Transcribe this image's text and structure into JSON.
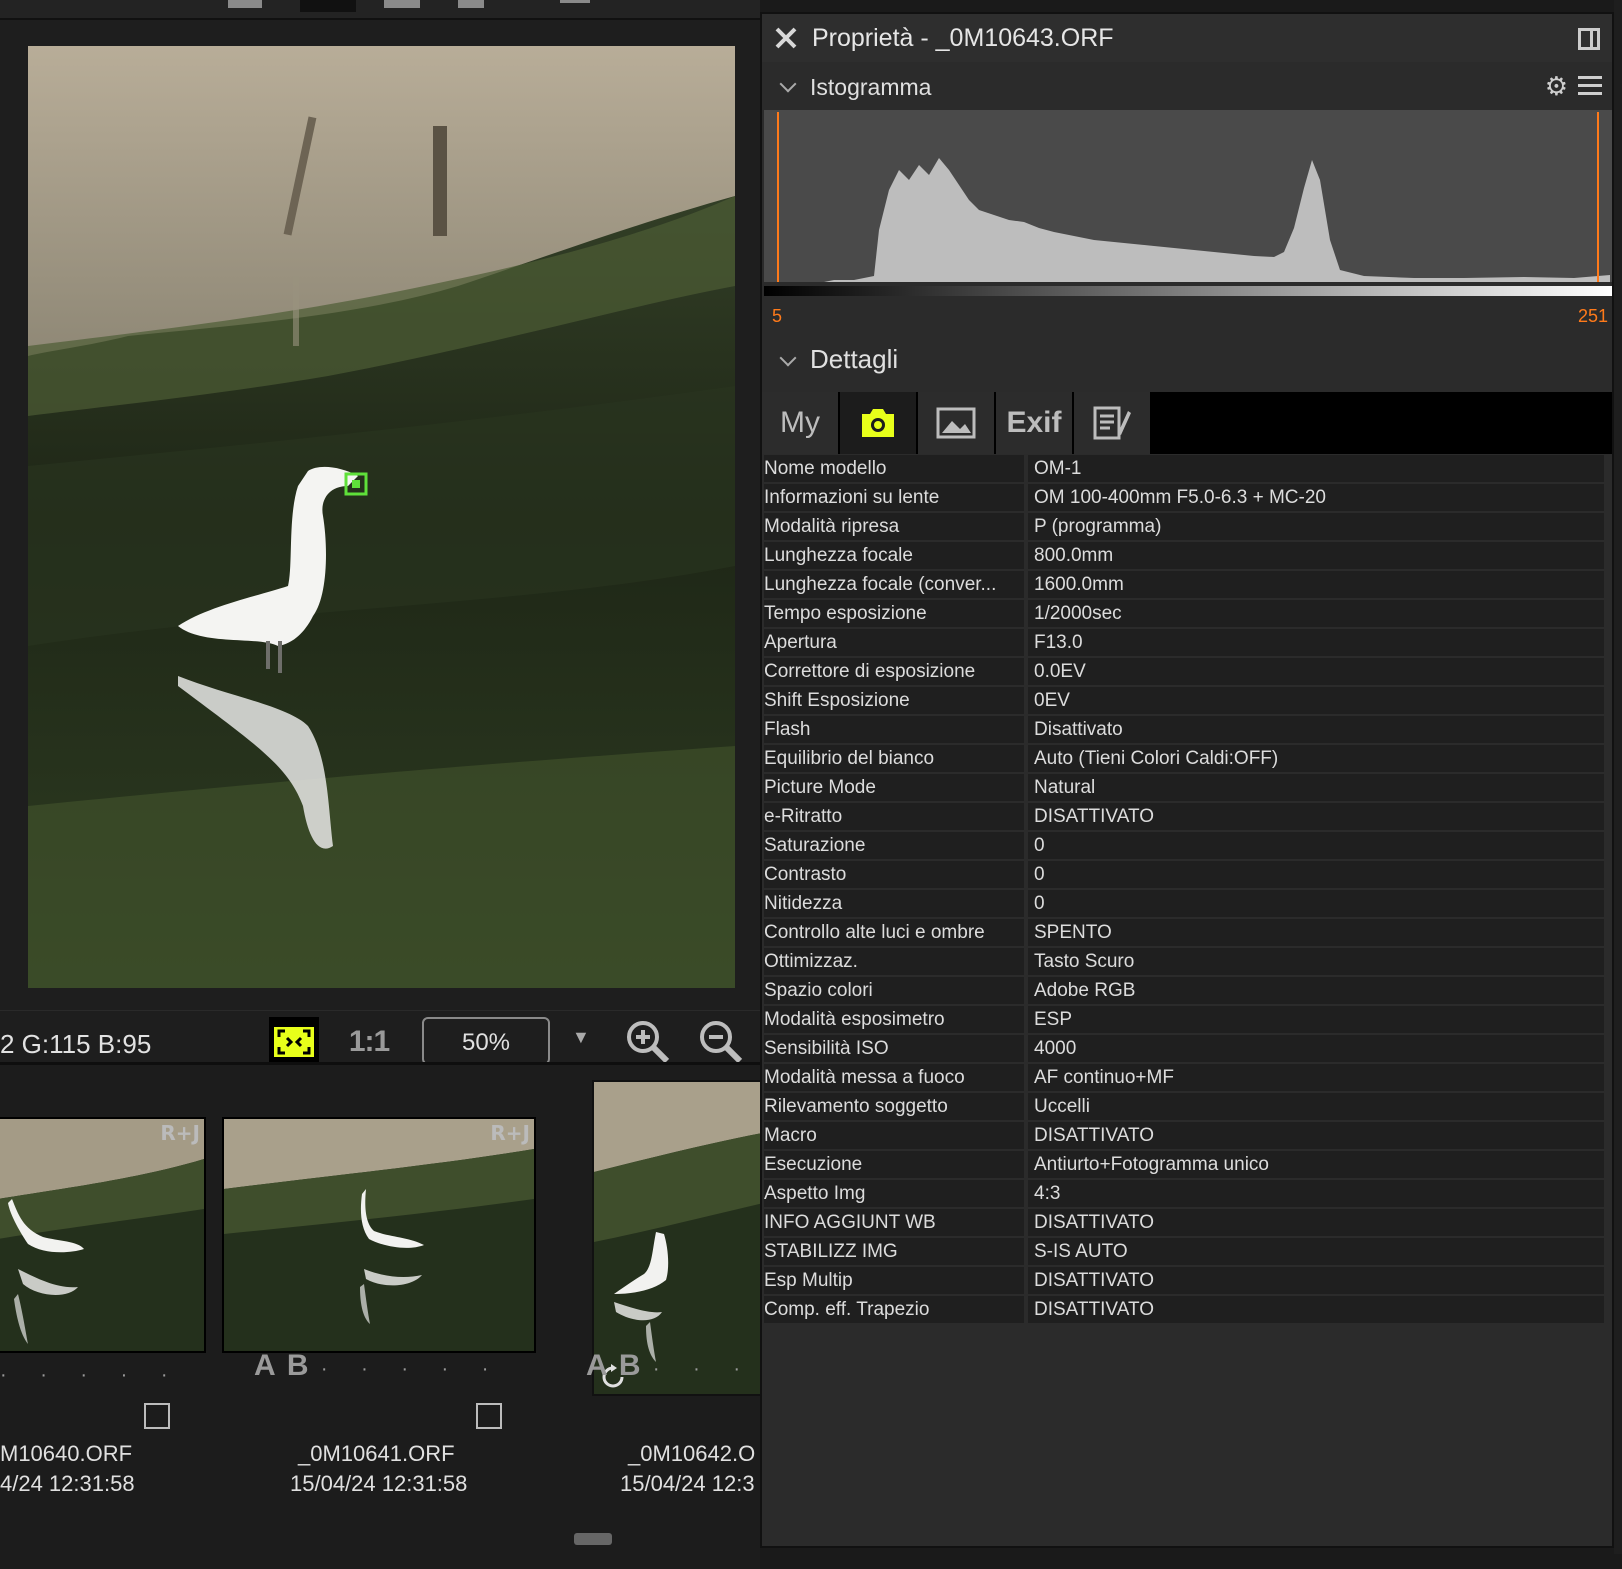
{
  "viewer": {
    "rgb_readout": "2 G:115 B:95",
    "one_to_one_label": "1:1",
    "zoom_value": "50%",
    "zoom_caret": "▼",
    "grip": "▪▪▪▪▪▪"
  },
  "filmstrip": {
    "items": [
      {
        "badge": "R+J",
        "rating_letters": "",
        "name": "M10640.ORF",
        "date": "4/24 12:31:58"
      },
      {
        "badge": "R+J",
        "rating_letters": "A B",
        "name": "_0M10641.ORF",
        "date": "15/04/24 12:31:58"
      },
      {
        "badge": "",
        "rating_letters": "A B",
        "name": "_0M10642.O",
        "date": "15/04/24 12:3"
      }
    ],
    "dots": "· · · · ·"
  },
  "properties": {
    "title": "Proprietà - _0M10643.ORF",
    "histogram": {
      "label": "Istogramma",
      "min_value": "5",
      "max_value": "251"
    },
    "details": {
      "label": "Dettagli",
      "tabs": [
        {
          "label": "My",
          "icon": ""
        },
        {
          "label": "",
          "icon": "camera-icon"
        },
        {
          "label": "",
          "icon": "image-icon"
        },
        {
          "label": "Exif",
          "icon": ""
        },
        {
          "label": "",
          "icon": "edit-note-icon"
        }
      ],
      "active_tab": 1,
      "rows": [
        {
          "key": "Nome modello",
          "value": "OM-1"
        },
        {
          "key": "Informazioni su lente",
          "value": "OM 100-400mm F5.0-6.3 + MC-20"
        },
        {
          "key": "Modalità ripresa",
          "value": "P (programma)"
        },
        {
          "key": "Lunghezza focale",
          "value": "800.0mm"
        },
        {
          "key": "Lunghezza focale (conver...",
          "value": "1600.0mm"
        },
        {
          "key": "Tempo esposizione",
          "value": "1/2000sec"
        },
        {
          "key": "Apertura",
          "value": "F13.0"
        },
        {
          "key": "Correttore di esposizione",
          "value": "0.0EV"
        },
        {
          "key": "Shift Esposizione",
          "value": "0EV"
        },
        {
          "key": "Flash",
          "value": "Disattivato"
        },
        {
          "key": "Equilibrio del bianco",
          "value": "Auto (Tieni Colori Caldi:OFF)"
        },
        {
          "key": "Picture Mode",
          "value": "Natural"
        },
        {
          "key": "e-Ritratto",
          "value": "DISATTIVATO"
        },
        {
          "key": "Saturazione",
          "value": "0"
        },
        {
          "key": "Contrasto",
          "value": "0"
        },
        {
          "key": "Nitidezza",
          "value": "0"
        },
        {
          "key": "Controllo alte luci e ombre",
          "value": "SPENTO"
        },
        {
          "key": "Ottimizzaz.",
          "value": "Tasto Scuro"
        },
        {
          "key": "Spazio colori",
          "value": "Adobe RGB"
        },
        {
          "key": "Modalità esposimetro",
          "value": "ESP"
        },
        {
          "key": "Sensibilità ISO",
          "value": "4000"
        },
        {
          "key": "Modalità messa a fuoco",
          "value": "AF continuo+MF"
        },
        {
          "key": "Rilevamento soggetto",
          "value": "Uccelli"
        },
        {
          "key": "Macro",
          "value": "DISATTIVATO"
        },
        {
          "key": "Esecuzione",
          "value": "Antiurto+Fotogramma unico"
        },
        {
          "key": "Aspetto Img",
          "value": "4:3"
        },
        {
          "key": "INFO AGGIUNT WB",
          "value": "DISATTIVATO"
        },
        {
          "key": "STABILIZZ IMG",
          "value": "S-IS AUTO"
        },
        {
          "key": "Esp Multip",
          "value": "DISATTIVATO"
        },
        {
          "key": "Comp. eff. Trapezio",
          "value": "DISATTIVATO"
        }
      ]
    }
  },
  "colors": {
    "accent_yellow": "#e8ff1a",
    "histogram_marker": "#ff7a1a",
    "focus_point": "#5fe03a"
  }
}
